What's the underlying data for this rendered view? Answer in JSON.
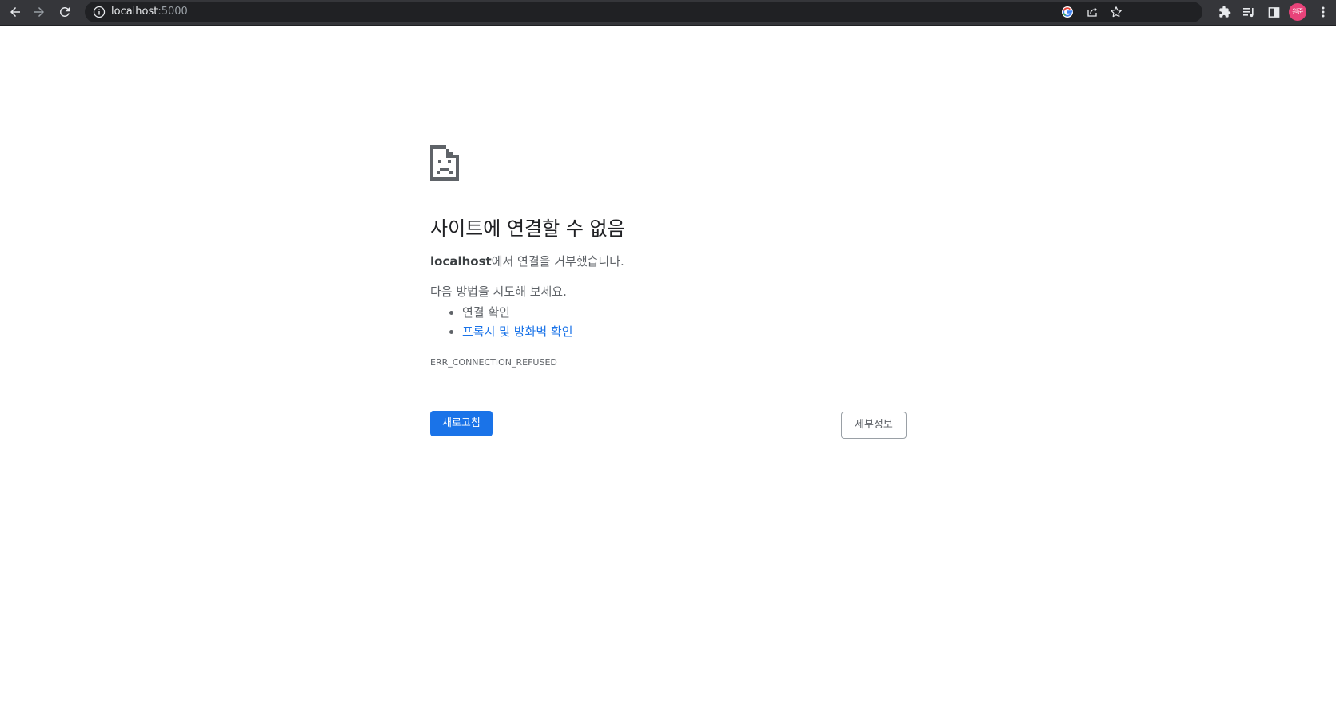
{
  "browser": {
    "url_host": "localhost",
    "url_port": ":5000",
    "profile_initials": "원준",
    "colors": {
      "toolbar": "#35363a",
      "omnibox": "#202124",
      "avatar": "#e8437a"
    },
    "icons": [
      "back-icon",
      "forward-icon",
      "reload-icon",
      "info-icon",
      "google-icon",
      "share-icon",
      "star-icon",
      "extensions-icon",
      "reading-list-icon",
      "side-panel-icon",
      "menu-icon"
    ]
  },
  "error_page": {
    "icon": "sad-page-icon",
    "heading": "사이트에 연결할 수 없음",
    "host": "localhost",
    "message_suffix": "에서 연결을 거부했습니다.",
    "suggestions_intro": "다음 방법을 시도해 보세요.",
    "suggestions": [
      "연결 확인",
      "프록시 및 방화벽 확인"
    ],
    "error_code": "ERR_CONNECTION_REFUSED",
    "reload_label": "새로고침",
    "details_label": "세부정보",
    "colors": {
      "primary_button": "#1a73e8",
      "link": "#1a73e8",
      "text": "#5f6368",
      "heading": "#202124"
    }
  }
}
